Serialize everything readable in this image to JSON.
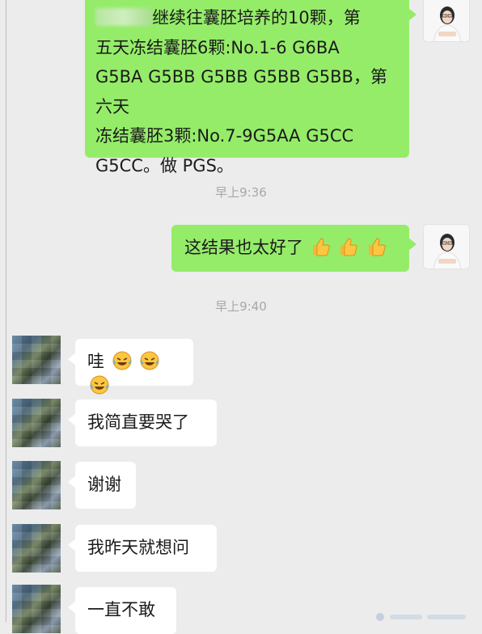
{
  "messages": [
    {
      "sender": "me",
      "text": "继续往囊胚培养的10颗，第五天冻结囊胚6颗:No.1-6 G6BA G5BA G5BB G5BB G5BB G5BB，第六天冻结囊胚3颗:No.7-9G5AA G5CC G5CC。做 PGS。",
      "lines": [
        "继续往囊胚培养的10颗，第",
        "五天冻结囊胚6颗:No.1-6 G6BA",
        "G5BA G5BB G5BB G5BB G5BB，第六天",
        "冻结囊胚3颗:No.7-9G5AA G5CC",
        "G5CC。做 PGS。"
      ]
    },
    {
      "timestamp": "早上9:36"
    },
    {
      "sender": "me",
      "text": "这结果也太好了",
      "emojis": [
        "thumbs-up-icon",
        "thumbs-up-icon",
        "thumbs-up-icon"
      ]
    },
    {
      "timestamp": "早上9:40"
    },
    {
      "sender": "them",
      "text": "哇",
      "emojis": [
        "crying-laughing-icon",
        "crying-laughing-icon",
        "crying-laughing-icon"
      ]
    },
    {
      "sender": "them",
      "text": "我简直要哭了"
    },
    {
      "sender": "them",
      "text": "谢谢"
    },
    {
      "sender": "them",
      "text": "我昨天就想问"
    },
    {
      "sender": "them",
      "text": "一直不敢"
    }
  ],
  "colors": {
    "background": "#ececec",
    "my_bubble": "#95ec69",
    "their_bubble": "#ffffff",
    "timestamp": "#a8a8a8"
  }
}
